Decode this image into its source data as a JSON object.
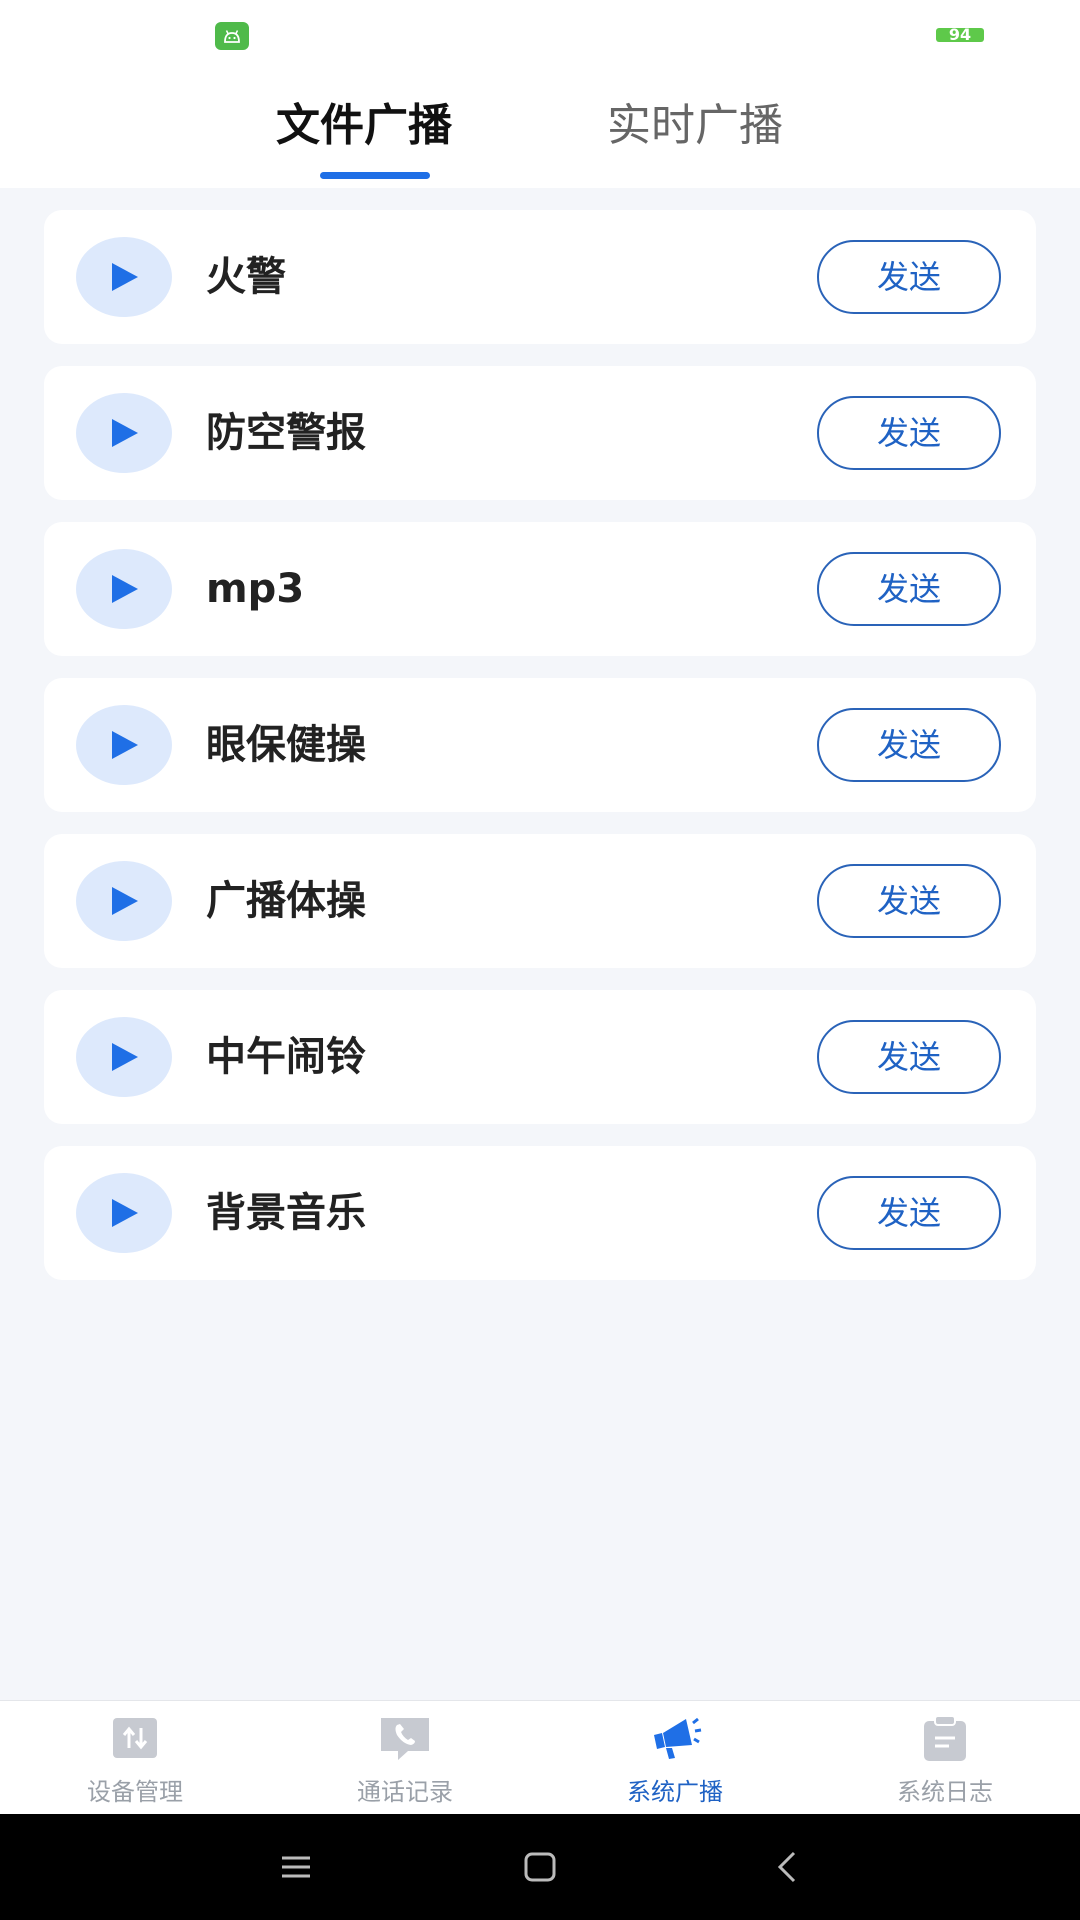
{
  "status_bar": {
    "battery_level": "94"
  },
  "tabs": [
    {
      "label": "文件广播",
      "active": true
    },
    {
      "label": "实时广播",
      "active": false
    }
  ],
  "broadcast_items": [
    {
      "title": "火警",
      "send_label": "发送"
    },
    {
      "title": "防空警报",
      "send_label": "发送"
    },
    {
      "title": "mp3",
      "send_label": "发送"
    },
    {
      "title": "眼保健操",
      "send_label": "发送"
    },
    {
      "title": "广播体操",
      "send_label": "发送"
    },
    {
      "title": "中午闹铃",
      "send_label": "发送"
    },
    {
      "title": "背景音乐",
      "send_label": "发送"
    }
  ],
  "bottom_nav": [
    {
      "label": "设备管理",
      "icon": "device-icon",
      "active": false
    },
    {
      "label": "通话记录",
      "icon": "phone-icon",
      "active": false
    },
    {
      "label": "系统广播",
      "icon": "megaphone-icon",
      "active": true
    },
    {
      "label": "系统日志",
      "icon": "clipboard-icon",
      "active": false
    }
  ],
  "system_nav": {
    "icons": [
      "menu-icon",
      "home-icon",
      "back-icon"
    ]
  },
  "colors": {
    "accent": "#1f6fe6",
    "send_border": "#2a63b8",
    "play_bg": "#dde9fc",
    "background": "#f4f6fa",
    "inactive_nav": "#c7cad1"
  }
}
